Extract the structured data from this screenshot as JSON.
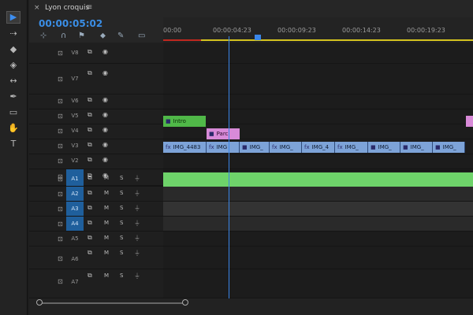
{
  "tab": {
    "close": "×",
    "title": "Lyon croquis",
    "menu": "≡"
  },
  "timecode": "00:00:05:02",
  "ruler_ticks": [
    "00:00",
    "00:00:04:23",
    "00:00:09:23",
    "00:00:14:23",
    "00:00:19:23"
  ],
  "video_tracks": [
    {
      "label": "V8"
    },
    {
      "label": "V7"
    },
    {
      "label": "V6"
    },
    {
      "label": "V5"
    },
    {
      "label": "V4"
    },
    {
      "label": "V3"
    },
    {
      "label": "V2"
    },
    {
      "label": "V1"
    }
  ],
  "audio_tracks": [
    {
      "label": "A1"
    },
    {
      "label": "A2"
    },
    {
      "label": "A3"
    },
    {
      "label": "A4"
    },
    {
      "label": "A5"
    },
    {
      "label": "A6"
    },
    {
      "label": "A7"
    }
  ],
  "audio_buttons": {
    "mute": "M",
    "solo": "S"
  },
  "clips": {
    "intro": "Intro",
    "parc": "Parc",
    "v2": [
      "IMG_4483",
      "IMG",
      "IMG_",
      "IMG_",
      "IMG_4",
      "IMG_",
      "IMG_",
      "IMG_",
      "IMG_"
    ]
  },
  "colors": {
    "accent": "#3a8ee6",
    "video_clip": "#7da3d8",
    "title_clip": "#50b848",
    "pink_clip": "#d88ad8",
    "audio_clip": "#6ed36a",
    "work_area": "#d4c21f"
  },
  "icons": {
    "selection-tool": "▶",
    "track-select-tool": "⇢",
    "ripple-edit-tool": "◆",
    "razor-tool": "◈",
    "slip-tool": "↔",
    "pen-tool": "✒",
    "rectangle-tool": "▭",
    "hand-tool": "✋",
    "type-tool": "T",
    "lock-icon": "🔓",
    "sync-icon": "⧉",
    "eye-icon": "◉",
    "mic-icon": "🎤"
  }
}
